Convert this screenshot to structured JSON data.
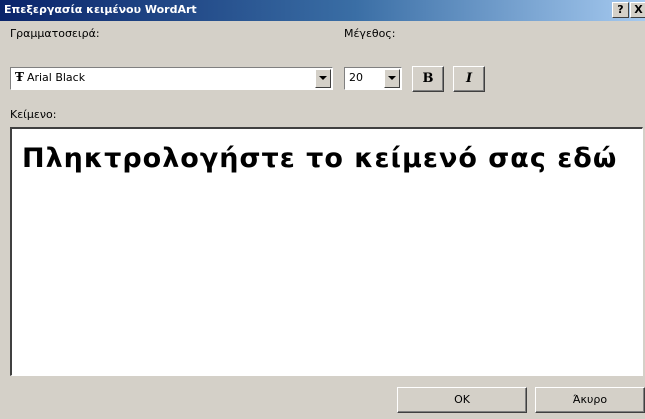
{
  "window": {
    "title": "Επεξεργασία κειμένου WordArt",
    "help_button": "?",
    "close_button": "X"
  },
  "font": {
    "label": "Γραμματοσειρά:",
    "value": "Arial Black",
    "icon": "truetype-font-icon"
  },
  "size": {
    "label": "Μέγεθος:",
    "value": "20"
  },
  "format": {
    "bold_label": "B",
    "italic_label": "I"
  },
  "text": {
    "label": "Κείμενο:",
    "value": "Πληκτρολογήστε το κείμενό σας εδώ"
  },
  "buttons": {
    "ok": "OK",
    "cancel": "Άκυρο"
  }
}
